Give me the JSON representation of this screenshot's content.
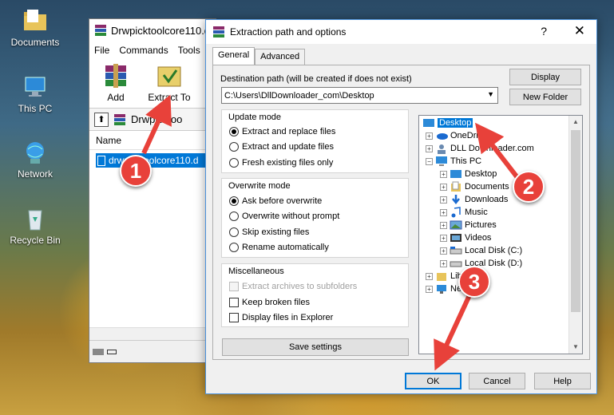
{
  "desktop": {
    "icons": [
      {
        "label": "Documents",
        "icon": "documents-folder-icon"
      },
      {
        "label": "This PC",
        "icon": "this-pc-icon"
      },
      {
        "label": "Network",
        "icon": "network-icon"
      },
      {
        "label": "Recycle Bin",
        "icon": "recycle-bin-icon"
      }
    ]
  },
  "winrar": {
    "title": "Drwpicktoolcore110.d",
    "menu": [
      "File",
      "Commands",
      "Tools"
    ],
    "toolbar": [
      {
        "label": "Add",
        "icon": "add-archive-icon"
      },
      {
        "label": "Extract To",
        "icon": "extract-to-icon"
      }
    ],
    "path": "Drwpicktoo",
    "list_header": "Name",
    "file": "drwpicktoolcore110.d"
  },
  "dialog": {
    "title": "Extraction path and options",
    "help": "?",
    "close": "✕",
    "tabs": [
      "General",
      "Advanced"
    ],
    "dest_label": "Destination path (will be created if does not exist)",
    "dest_value": "C:\\Users\\DllDownloader_com\\Desktop",
    "display_btn": "Display",
    "new_folder_btn": "New Folder",
    "update_mode": {
      "title": "Update mode",
      "options": [
        "Extract and replace files",
        "Extract and update files",
        "Fresh existing files only"
      ],
      "selected": 0
    },
    "overwrite_mode": {
      "title": "Overwrite mode",
      "options": [
        "Ask before overwrite",
        "Overwrite without prompt",
        "Skip existing files",
        "Rename automatically"
      ],
      "selected": 0
    },
    "misc": {
      "title": "Miscellaneous",
      "options": [
        "Extract archives to subfolders",
        "Keep broken files",
        "Display files in Explorer"
      ]
    },
    "save_settings": "Save settings",
    "tree": {
      "desktop": "Desktop",
      "onedrive": "OneDrive",
      "dlldownloader": "DLL Downloader.com",
      "thispc": "This PC",
      "pc_items": [
        "Desktop",
        "Documents",
        "Downloads",
        "Music",
        "Pictures",
        "Videos",
        "Local Disk (C:)",
        "Local Disk (D:)"
      ],
      "libraries": "Libraries",
      "network": "Network"
    },
    "ok": "OK",
    "cancel": "Cancel",
    "helpbtn": "Help"
  },
  "annotations": [
    "1",
    "2",
    "3"
  ],
  "colors": {
    "accent": "#0078d7",
    "annotation": "#e8413a"
  }
}
